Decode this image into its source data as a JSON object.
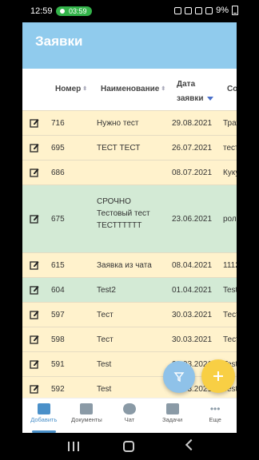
{
  "status_bar": {
    "time": "12:59",
    "call_timer": "03:59",
    "battery": "9%"
  },
  "header": {
    "title": "Заявки"
  },
  "table": {
    "columns": [
      {
        "label": "Номер"
      },
      {
        "label": "Наименование"
      },
      {
        "label_line1": "Дата",
        "label_line2": "заявки"
      },
      {
        "label": "Со"
      }
    ],
    "rows": [
      {
        "number": "716",
        "name": "Нужно тест",
        "date": "29.08.2021",
        "extra": "Трат",
        "color": "yellow"
      },
      {
        "number": "695",
        "name": "ТЕСТ ТЕСТ",
        "date": "26.07.2021",
        "extra": "тест",
        "color": "yellow"
      },
      {
        "number": "686",
        "name": "",
        "date": "08.07.2021",
        "extra": "Куку",
        "color": "yellow"
      },
      {
        "number": "675",
        "name_lines": [
          "СРОЧНО",
          "Тестовый тест",
          "ТЕСТТТТТТ"
        ],
        "date": "23.06.2021",
        "extra": "рол",
        "color": "green"
      },
      {
        "number": "615",
        "name": "Заявка из чата",
        "date": "08.04.2021",
        "extra": "1112",
        "color": "yellow"
      },
      {
        "number": "604",
        "name": "Test2",
        "date": "01.04.2021",
        "extra": "Test",
        "color": "green"
      },
      {
        "number": "597",
        "name": "Тест",
        "date": "30.03.2021",
        "extra": "Тест",
        "color": "yellow"
      },
      {
        "number": "598",
        "name": "Тест",
        "date": "30.03.2021",
        "extra": "Тест",
        "color": "yellow"
      },
      {
        "number": "591",
        "name": "Test",
        "date": "29.03.2021",
        "extra": "Test",
        "color": "yellow"
      },
      {
        "number": "592",
        "name": "Test",
        "date": "29.03.2021",
        "extra": "Test",
        "color": "yellow"
      },
      {
        "number": "",
        "name": "",
        "date": "",
        "extra": "",
        "color": "green"
      }
    ]
  },
  "bottom_nav": [
    {
      "label": "Добавить",
      "icon": "add-document-icon",
      "active": true
    },
    {
      "label": "Документы",
      "icon": "folder-icon",
      "active": false
    },
    {
      "label": "Чат",
      "icon": "chat-icon",
      "active": false
    },
    {
      "label": "Задачи",
      "icon": "tasks-icon",
      "active": false
    },
    {
      "label": "Еще",
      "icon": "more-icon",
      "active": false
    }
  ],
  "colors": {
    "header": "#90cbed",
    "row_yellow": "#fff2cc",
    "row_green": "#d3ead5",
    "fab_filter": "#8fc2e9",
    "fab_add": "#f8cf44",
    "accent": "#4a90c9"
  }
}
